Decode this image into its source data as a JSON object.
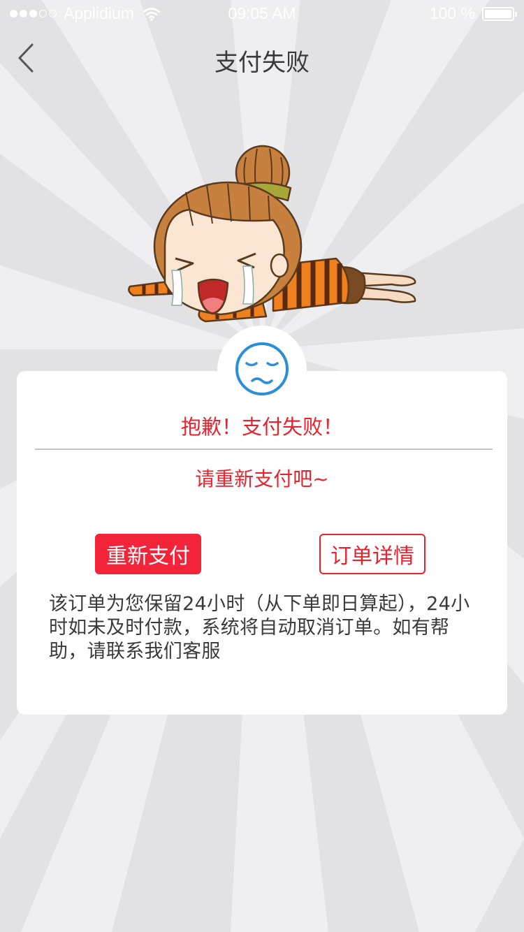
{
  "status_bar": {
    "carrier": "Applidium",
    "time": "09:05 AM",
    "battery_text": "100 %",
    "battery_level": 1.0,
    "signal_bars_filled": 3,
    "signal_bars_total": 5
  },
  "nav": {
    "title": "支付失败",
    "back_icon": "chevron-left-icon"
  },
  "result": {
    "face_icon": "sad-face-icon",
    "title": "抱歉！支付失败！",
    "subtitle": "请重新支付吧~",
    "repay_label": "重新支付",
    "detail_label": "订单详情",
    "notice": "该订单为您保留24小时（从下单即日算起），24小时如未及时付款，系统将自动取消订单。如有帮助，请联系我们客服"
  },
  "colors": {
    "accent_red": "#e8232d",
    "button_red": "#f2243a",
    "icon_blue": "#2a8fd6",
    "background": "#e4e4e6"
  }
}
